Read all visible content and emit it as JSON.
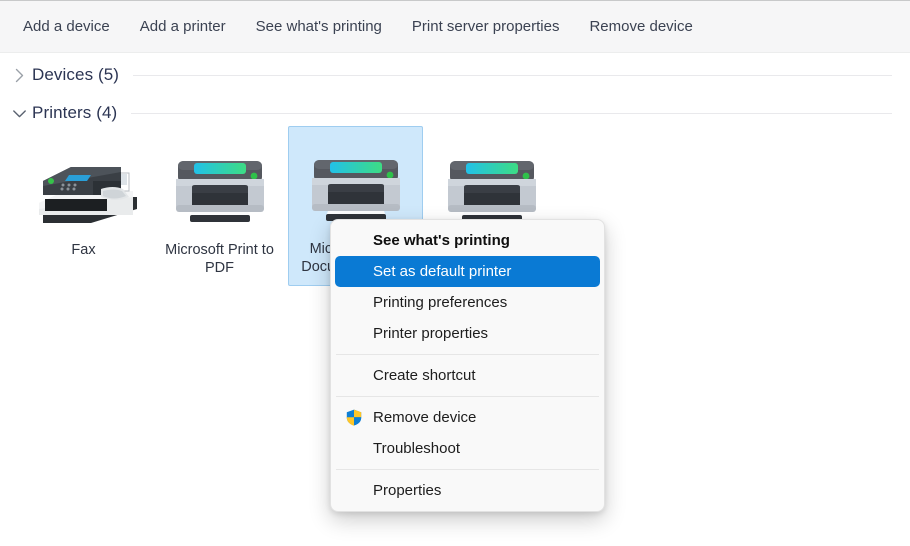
{
  "toolbar": {
    "items": [
      {
        "label": "Add a device",
        "name": "toolbar-add-a-device"
      },
      {
        "label": "Add a printer",
        "name": "toolbar-add-a-printer"
      },
      {
        "label": "See what's printing",
        "name": "toolbar-see-whats-printing"
      },
      {
        "label": "Print server properties",
        "name": "toolbar-print-server-properties"
      },
      {
        "label": "Remove device",
        "name": "toolbar-remove-device"
      }
    ]
  },
  "groups": [
    {
      "title": "Devices (5)",
      "expanded": false,
      "chevron": "chevron-right-icon"
    },
    {
      "title": "Printers (4)",
      "expanded": true,
      "chevron": "chevron-down-icon"
    }
  ],
  "devices": [
    {
      "label": "Fax",
      "icon": "fax-icon",
      "selected": false
    },
    {
      "label": "Microsoft Print to PDF",
      "icon": "printer-icon",
      "selected": false
    },
    {
      "label": "Microsoft XPS Document Writer",
      "icon": "printer-icon",
      "selected": true
    },
    {
      "label": "",
      "icon": "printer-icon",
      "selected": false
    }
  ],
  "context_menu": {
    "items": [
      {
        "label": "See what's printing",
        "type": "item",
        "bold": true,
        "highlighted": false,
        "icon": null
      },
      {
        "label": "Set as default printer",
        "type": "item",
        "bold": false,
        "highlighted": true,
        "icon": null
      },
      {
        "label": "Printing preferences",
        "type": "item",
        "bold": false,
        "highlighted": false,
        "icon": null
      },
      {
        "label": "Printer properties",
        "type": "item",
        "bold": false,
        "highlighted": false,
        "icon": null
      },
      {
        "label": "",
        "type": "separator"
      },
      {
        "label": "Create shortcut",
        "type": "item",
        "bold": false,
        "highlighted": false,
        "icon": null
      },
      {
        "label": "",
        "type": "separator"
      },
      {
        "label": "Remove device",
        "type": "item",
        "bold": false,
        "highlighted": false,
        "icon": "uac-shield-icon"
      },
      {
        "label": "Troubleshoot",
        "type": "item",
        "bold": false,
        "highlighted": false,
        "icon": null
      },
      {
        "label": "",
        "type": "separator"
      },
      {
        "label": "Properties",
        "type": "item",
        "bold": false,
        "highlighted": false,
        "icon": null
      }
    ]
  },
  "colors": {
    "toolbar_background": "#f6f6f7",
    "toolbar_text": "#3b4252",
    "group_title": "#2c3553",
    "selection_background": "#cfe8fb",
    "selection_border": "#9fcdf0",
    "menu_background": "#f9f9f9",
    "menu_highlight": "#0a7ad4",
    "menu_text": "#1d1d1d",
    "shield_blue": "#0f7fd4",
    "shield_yellow": "#ffc627",
    "printer_top": "#55585f",
    "printer_body": "#c3c9d1",
    "printer_lid_gradient_start": "#22c1e8",
    "printer_lid_gradient_end": "#3ddc84",
    "printer_led": "#2fc14a"
  }
}
